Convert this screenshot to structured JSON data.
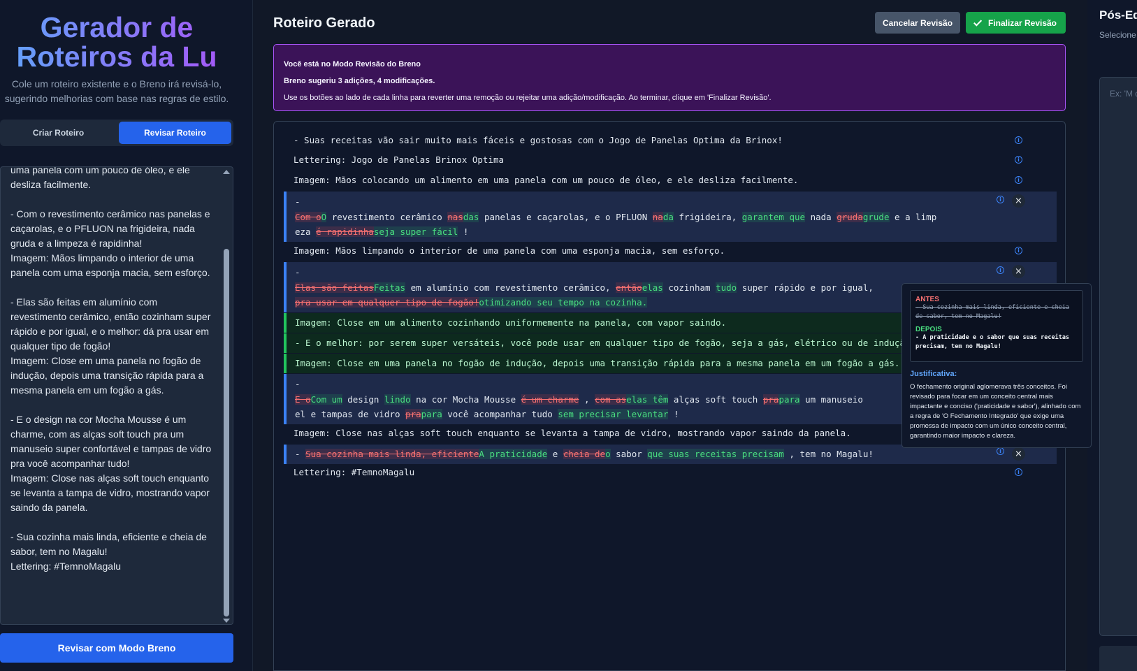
{
  "left": {
    "title_line1": "Gerador de",
    "title_line2": "Roteiros da Lu",
    "subtitle": "Cole um roteiro existente e o Breno irá revisá-lo, sugerindo melhorias com base nas regras de estilo.",
    "tabs": [
      {
        "label": "Criar Roteiro",
        "active": false
      },
      {
        "label": "Revisar Roteiro",
        "active": true
      }
    ],
    "input_text": "uma panela com um pouco de óleo, e ele\ndesliza facilmente.\n\n- Com o revestimento cerâmico nas panelas e\ncaçarolas, e o PFLUON na frigideira, nada\ngruda e a limpeza é rapidinha!\nImagem: Mãos limpando o interior de uma\npanela com uma esponja macia, sem esforço.\n\n- Elas são feitas em alumínio com\nrevestimento cerâmico, então cozinham super\nrápido e por igual, e o melhor: dá pra usar em\nqualquer tipo de fogão!\nImagem: Close em uma panela no fogão de\nindução, depois uma transição rápida para a\nmesma panela em um fogão a gás.\n\n- E o design na cor Mocha Mousse é um\ncharme, com as alças soft touch pra um\nmanuseio super confortável e tampas de vidro\npra você acompanhar tudo!\nImagem: Close nas alças soft touch enquanto\nse levanta a tampa de vidro, mostrando vapor\nsaindo da panela.\n\n- Sua cozinha mais linda, eficiente e cheia de\nsabor, tem no Magalu!\nLettering: #TemnoMagalu",
    "review_button": "Revisar com Modo Breno"
  },
  "main": {
    "title": "Roteiro Gerado",
    "cancel_label": "Cancelar Revisão",
    "finalize_label": "Finalizar Revisão",
    "banner": {
      "line1": "Você está no Modo Revisão do Breno",
      "line2": "Breno sugeriu 3 adições, 4 modificações.",
      "line3": "Use os botões ao lado de cada linha para reverter uma remoção ou rejeitar uma adição/modificação. Ao terminar, clique em 'Finalizar Revisão'."
    },
    "lines": {
      "l1": "- Suas receitas vão sair muito mais fáceis e gostosas com o Jogo de Panelas Optima da Brinox!",
      "l2": "Lettering: Jogo de Panelas Brinox Optima",
      "l3": "Imagem: Mãos colocando um alimento em uma panela com um pouco de óleo, e ele desliza facilmente.",
      "m1": {
        "dash": "-",
        "d1": "Com o",
        "i1": "O",
        "t1": " revestimento cerâmico ",
        "d2": "nas",
        "i2": "das",
        "t2": " panelas e caçarolas, e o PFLUON ",
        "d3": "na",
        "i3": "da",
        "t3": " frigideira, ",
        "i4": "garantem que",
        "t4": " nada ",
        "d5": "gruda",
        "i5": "grude",
        "t5": " e a limp",
        "t6": "eza ",
        "d6": "é rapidinha",
        "i6": "seja super fácil",
        "t7": " !"
      },
      "l5": "Imagem: Mãos limpando o interior de uma panela com uma esponja macia, sem esforço.",
      "m2": {
        "dash": "-",
        "d1": "Elas são feitas",
        "i1": "Feitas",
        "t1": " em alumínio com revestimento cerâmico, ",
        "d2": "então",
        "i2": "elas",
        "t2": " cozinham ",
        "i3": "tudo",
        "t3": " super rápido e por igual,",
        "d4": "pra usar em qualquer tipo de fogão!",
        "i4": "otimizando seu tempo na cozinha."
      },
      "a1": "Imagem: Close em um alimento cozinhando uniformemente na panela, com vapor saindo.",
      "a2": "- E o melhor: por serem super versáteis, você pode usar em qualquer tipo de fogão, seja a gás, elétrico ou de indução!",
      "a3": "Imagem: Close em uma panela no fogão de indução, depois uma transição rápida para a mesma panela em um fogão a gás.",
      "m3": {
        "dash": "-",
        "d1": "E o",
        "i1": "Com um",
        "t1": " design ",
        "i2": "lindo",
        "t2": " na cor Mocha Mousse ",
        "d3": "é um charme",
        "t3": " , ",
        "d4": "com as",
        "i4": "elas têm",
        "t4": " alças soft touch ",
        "d5": "pra",
        "i5": "para",
        "t5": " um manuseio",
        "t6": "el e tampas de vidro ",
        "d7": "pra",
        "i7": "para",
        "t7": " você acompanhar tudo ",
        "i8": "sem precisar levantar",
        "t8": " !"
      },
      "l10": "Imagem: Close nas alças soft touch enquanto se levanta a tampa de vidro, mostrando vapor saindo da panela.",
      "m4": {
        "dash": "- ",
        "d1": "Sua cozinha mais linda, eficiente",
        "i1": "A praticidade",
        "t1": " e ",
        "d2": "cheia de",
        "i2": "o",
        "t2": " sabor ",
        "i3": "que suas receitas precisam",
        "t3": " , tem no Magalu!"
      },
      "l12": "Lettering: #TemnoMagalu"
    },
    "tooltip": {
      "before_label": "ANTES",
      "before_text": "- Sua cozinha mais linda, eficiente e cheia de sabor, tem no Magalu!",
      "after_label": "DEPOIS",
      "after_text": "- A praticidade e o sabor que suas receitas precisam, tem no Magalu!",
      "justification_label": "Justificativa:",
      "justification_text": "O fechamento original aglomerava três conceitos. Foi revisado para focar em um conceito central mais impactante e conciso ('praticidade e sabor'), alinhado com a regra de 'O Fechamento Integrado' que exige uma promessa de impacto com um único conceito central, garantindo maior impacto e clareza."
    }
  },
  "right": {
    "title": "Pós-Ed",
    "description": "Selecione lápis para inteiro ab",
    "placeholder": "Ex: 'M d'águ"
  }
}
